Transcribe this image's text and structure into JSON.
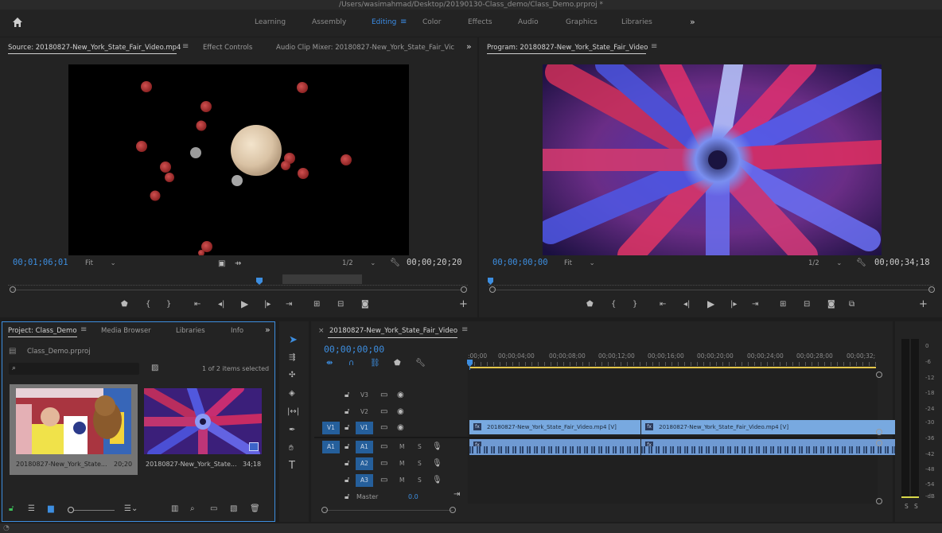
{
  "title_bar": {
    "path": "/Users/wasimahmad/Desktop/20190130-Class_demo/Class_Demo.prproj *"
  },
  "workspaces": [
    "Learning",
    "Assembly",
    "Editing",
    "Color",
    "Effects",
    "Audio",
    "Graphics",
    "Libraries"
  ],
  "workspace_active": "Editing",
  "source_panel": {
    "tab_source": "Source: 20180827-New_York_State_Fair_Video.mp4",
    "tab_effect_controls": "Effect Controls",
    "tab_audio_mixer": "Audio Clip Mixer: 20180827-New_York_State_Fair_Vic",
    "timecode_current": "00;01;06;01",
    "zoom": "Fit",
    "resolution": "1/2",
    "timecode_duration": "00;00;20;20"
  },
  "program_panel": {
    "tab": "Program: 20180827-New_York_State_Fair_Video",
    "timecode_current": "00;00;00;00",
    "zoom": "Fit",
    "resolution": "1/2",
    "timecode_duration": "00;00;34;18"
  },
  "project_panel": {
    "tabs": [
      "Project: Class_Demo",
      "Media Browser",
      "Libraries",
      "Info"
    ],
    "project_file": "Class_Demo.prproj",
    "selection_info": "1 of 2 items selected",
    "items": [
      {
        "name": "20180827-New_York_State...",
        "duration": "20;20",
        "selected": true
      },
      {
        "name": "20180827-New_York_State...",
        "duration": "34;18",
        "selected": false
      }
    ]
  },
  "timeline": {
    "sequence_tab": "20180827-New_York_State_Fair_Video",
    "timecode": "00;00;00;00",
    "ruler_labels": [
      ":00;00",
      "00;00;04;00",
      "00;00;08;00",
      "00;00;12;00",
      "00;00;16;00",
      "00;00;20;00",
      "00;00;24;00",
      "00;00;28;00",
      "00;00;32;"
    ],
    "video_tracks": [
      {
        "name": "V3",
        "source": ""
      },
      {
        "name": "V2",
        "source": ""
      },
      {
        "name": "V1",
        "source": "V1"
      }
    ],
    "audio_tracks": [
      {
        "name": "A1",
        "source": "A1"
      },
      {
        "name": "A2",
        "source": ""
      },
      {
        "name": "A3",
        "source": ""
      }
    ],
    "mute_label": "M",
    "solo_label": "S",
    "master": {
      "label": "Master",
      "value": "0.0"
    },
    "clips": [
      {
        "label": "20180827-New_York_State_Fair_Video.mp4 [V]",
        "start_sec": 0,
        "end_sec": 13.9
      },
      {
        "label": "20180827-New_York_State_Fair_Video.mp4 [V]",
        "start_sec": 13.9,
        "end_sec": 34.6
      }
    ],
    "fx_label": "fx"
  },
  "audio_meter": {
    "scale": [
      "0",
      "-6",
      "-12",
      "-18",
      "-24",
      "-30",
      "-36",
      "-42",
      "-48",
      "-54",
      "-dB"
    ],
    "solo_buttons": [
      "S",
      "S"
    ]
  },
  "colors": {
    "accent_blue": "#3d8ee0",
    "clip_blue": "#78a9e0",
    "playhead": "#3d8ee0",
    "work_area": "#e6c84a"
  }
}
